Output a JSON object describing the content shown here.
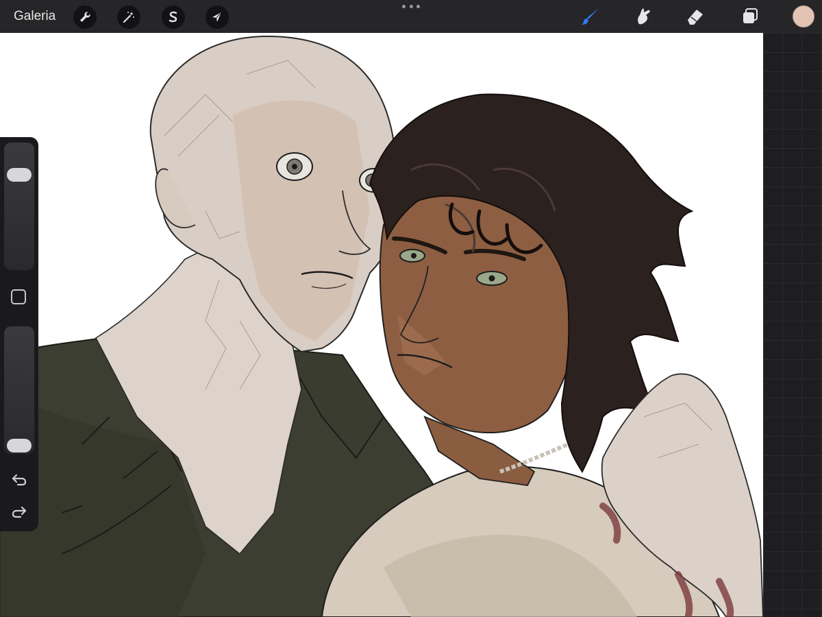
{
  "toolbar": {
    "gallery_label": "Galeria",
    "left_tools": [
      {
        "name": "wrench-icon",
        "label": "actions"
      },
      {
        "name": "magic-wand-icon",
        "label": "adjustments"
      },
      {
        "name": "selection-s-icon",
        "label": "selection"
      },
      {
        "name": "arrow-cursor-icon",
        "label": "transform"
      }
    ],
    "right_tools": [
      {
        "name": "brush-icon",
        "active": true
      },
      {
        "name": "smudge-icon",
        "active": false
      },
      {
        "name": "eraser-icon",
        "active": false
      },
      {
        "name": "layers-icon",
        "active": false
      }
    ],
    "current_color": "#e2c3b4",
    "active_tool_color": "#2f7bf5"
  },
  "sidebar": {
    "brush_size": 0.85,
    "opacity": 0.0,
    "undo_icon": "undo-icon",
    "redo_icon": "redo-icon",
    "modify_icon": "square-modify-icon"
  },
  "canvas": {
    "background": "#ffffff",
    "workspace_color": "#1e1e20"
  }
}
